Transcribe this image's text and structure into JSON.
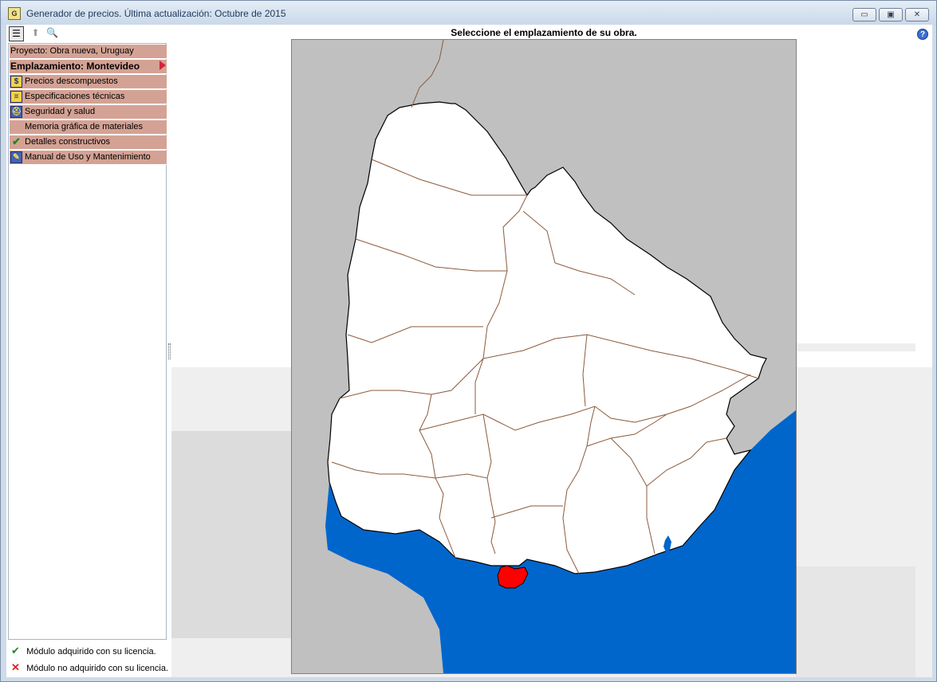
{
  "window": {
    "title": "Generador de precios. Última actualización: Octubre de 2015",
    "app_icon_glyph": "G"
  },
  "window_controls": {
    "minimize": "▭",
    "maximize": "▣",
    "close": "✕"
  },
  "toolbar": {
    "list_icon": "☰",
    "up_icon": "⬆",
    "find_icon": "🔍"
  },
  "map": {
    "title": "Seleccione el emplazamiento de su obra.",
    "selected_region": "Montevideo",
    "colors": {
      "ocean": "#0066cc",
      "neighbor_land": "#c0c0c0",
      "country": "#ffffff",
      "selected": "#ff0000",
      "borders": "#8b5a3c"
    }
  },
  "help_icon": "?",
  "menu": {
    "project": "Proyecto: Obra nueva, Uruguay",
    "location": "Emplazamiento: Montevideo",
    "items": [
      {
        "label": "Precios descompuestos",
        "icon": "coins-icon",
        "glyph": "$"
      },
      {
        "label": "Especificaciones técnicas",
        "icon": "document-icon",
        "glyph": "≡"
      },
      {
        "label": "Seguridad y salud",
        "icon": "helmet-icon",
        "glyph": "⛑"
      },
      {
        "label": "Memoria gráfica de materiales",
        "icon": "",
        "glyph": ""
      },
      {
        "label": "Detalles constructivos",
        "icon": "check-icon",
        "glyph": "✔"
      },
      {
        "label": "Manual de Uso y Mantenimiento",
        "icon": "tools-icon",
        "glyph": "✎"
      }
    ]
  },
  "legend": {
    "acquired": "Módulo adquirido con su licencia.",
    "not_acquired": "Módulo no adquirido con su licencia.",
    "acquired_icon": "✔",
    "not_acquired_icon": "✕"
  }
}
